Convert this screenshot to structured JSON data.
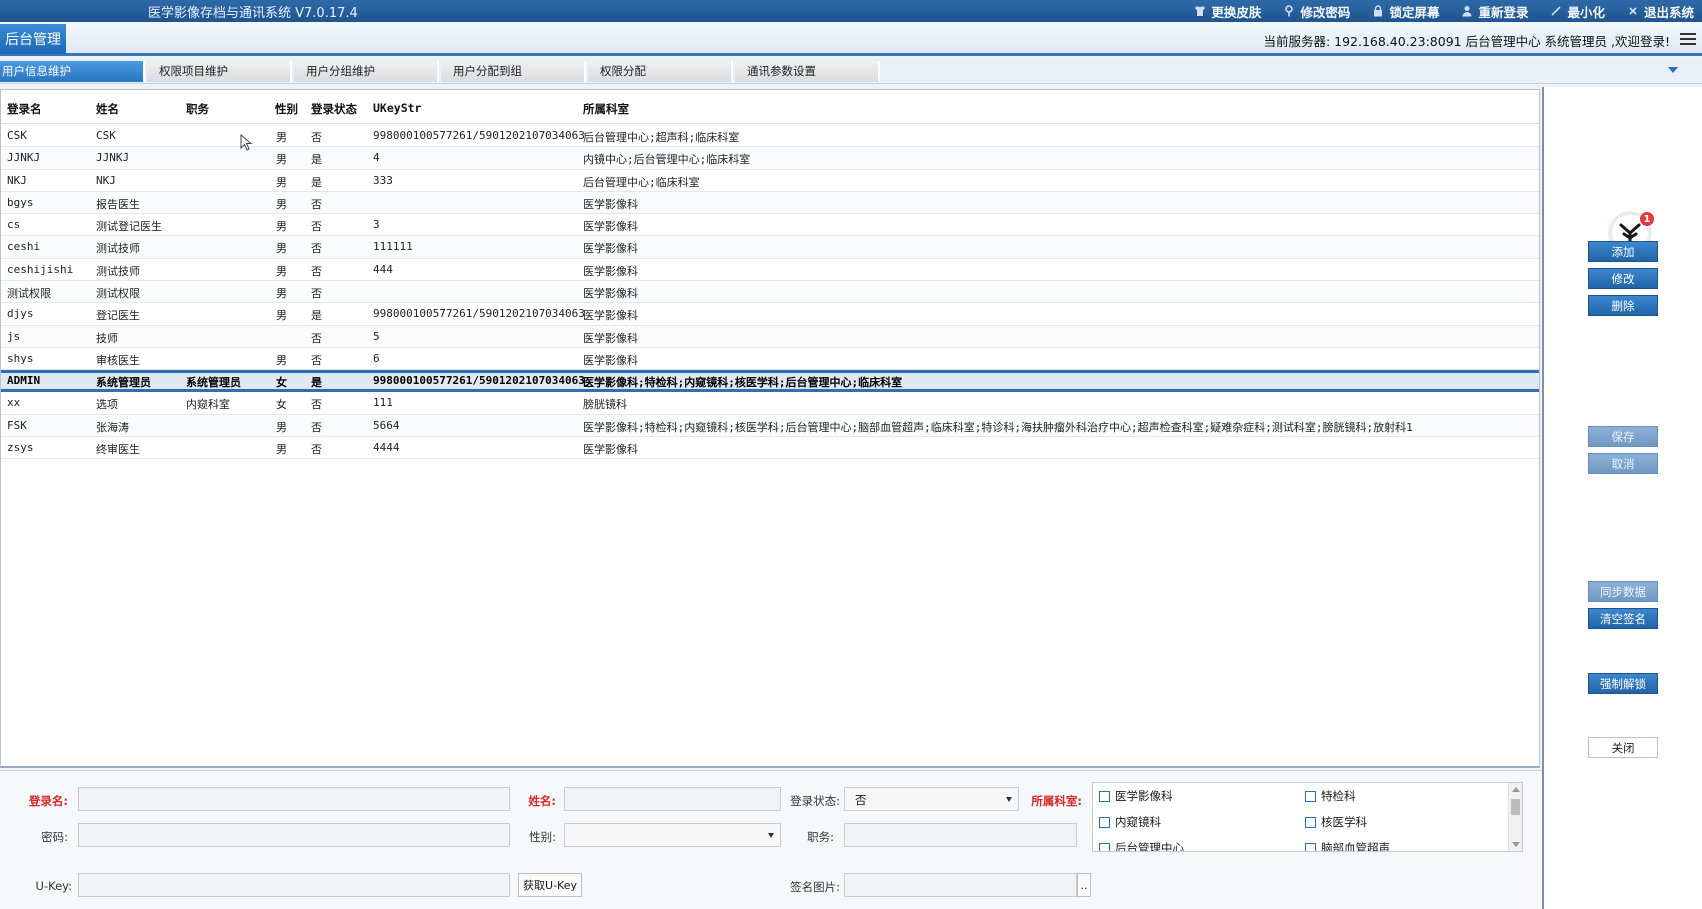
{
  "window": {
    "title": "医学影像存档与通讯系统 V7.0.17.4",
    "actions": [
      {
        "label": "更换皮肤",
        "icon": "shirt-icon"
      },
      {
        "label": "修改密码",
        "icon": "key-icon"
      },
      {
        "label": "锁定屏幕",
        "icon": "lock-icon"
      },
      {
        "label": "重新登录",
        "icon": "user-icon"
      },
      {
        "label": "最小化",
        "icon": "minimize-icon"
      },
      {
        "label": "退出系统",
        "icon": "exit-icon"
      }
    ]
  },
  "header": {
    "module": "后台管理",
    "server_info": "当前服务器: 192.168.40.23:8091 后台管理中心 系统管理员 ,欢迎登录!"
  },
  "tabs": [
    {
      "label": "用户信息维护",
      "active": true
    },
    {
      "label": "权限项目维护",
      "active": false
    },
    {
      "label": "用户分组维护",
      "active": false
    },
    {
      "label": "用户分配到组",
      "active": false
    },
    {
      "label": "权限分配",
      "active": false
    },
    {
      "label": "通讯参数设置",
      "active": false
    }
  ],
  "table": {
    "columns": [
      "登录名",
      "姓名",
      "职务",
      "性别",
      "登录状态",
      "UKeyStr",
      "所属科室"
    ],
    "rows": [
      [
        "CSK",
        "CSK",
        "",
        "男",
        "否",
        "998000100577261/5901202107034063",
        "后台管理中心;超声科;临床科室"
      ],
      [
        "JJNKJ",
        "JJNKJ",
        "",
        "男",
        "是",
        "4",
        "内镜中心;后台管理中心;临床科室"
      ],
      [
        "NKJ",
        "NKJ",
        "",
        "男",
        "是",
        "333",
        "后台管理中心;临床科室"
      ],
      [
        "bgys",
        "报告医生",
        "",
        "男",
        "否",
        "",
        "医学影像科"
      ],
      [
        "cs",
        "测试登记医生",
        "",
        "男",
        "否",
        "3",
        "医学影像科"
      ],
      [
        "ceshi",
        "测试技师",
        "",
        "男",
        "否",
        "111111",
        "医学影像科"
      ],
      [
        "ceshijishi",
        "测试技师",
        "",
        "男",
        "否",
        "444",
        "医学影像科"
      ],
      [
        "测试权限",
        "测试权限",
        "",
        "男",
        "否",
        "",
        "医学影像科"
      ],
      [
        "djys",
        "登记医生",
        "",
        "男",
        "是",
        "998000100577261/5901202107034063",
        "医学影像科"
      ],
      [
        "js",
        "技师",
        "",
        "",
        "否",
        "5",
        "医学影像科"
      ],
      [
        "shys",
        "审核医生",
        "",
        "男",
        "否",
        "6",
        "医学影像科"
      ],
      [
        "ADMIN",
        "系统管理员",
        "系统管理员",
        "女",
        "是",
        "998000100577261/5901202107034063",
        "医学影像科;特检科;内窥镜科;核医学科;后台管理中心;临床科室"
      ],
      [
        "xx",
        "选项",
        "内窥科室",
        "女",
        "否",
        "111",
        "膀胱镜科"
      ],
      [
        "FSK",
        "张海涛",
        "",
        "男",
        "否",
        "5664",
        "医学影像科;特检科;内窥镜科;核医学科;后台管理中心;脑部血管超声;临床科室;特诊科;海扶肿瘤外科治疗中心;超声检查科室;疑难杂症科;测试科室;膀胱镜科;放射科1"
      ],
      [
        "zsys",
        "终审医生",
        "",
        "男",
        "否",
        "4444",
        "医学影像科"
      ]
    ],
    "selected_row": 11
  },
  "side_buttons": {
    "add": "添加",
    "edit": "修改",
    "delete": "删除",
    "save": "保存",
    "cancel": "取消",
    "sync": "同步数据",
    "clear_sign": "清空签名",
    "force_unlock": "强制解锁",
    "close": "关闭",
    "badge_count": "1"
  },
  "form": {
    "login_label": "登录名:",
    "login_value": "",
    "name_label": "姓名:",
    "name_value": "",
    "status_label": "登录状态:",
    "status_value": "否",
    "dept_label": "所属科室:",
    "password_label": "密码:",
    "password_value": "",
    "gender_label": "性别:",
    "gender_value": "",
    "title_label": "职务:",
    "title_value": "",
    "ukey_label": "U-Key:",
    "ukey_value": "",
    "get_ukey": "获取U-Key",
    "sign_label": "签名图片:",
    "sign_value": "",
    "browse": "..",
    "departments": [
      "医学影像科",
      "特检科",
      "内窥镜科",
      "核医学科",
      "后台管理中心",
      "脑部血管超声"
    ]
  },
  "colors": {
    "accent": "#2a74c2",
    "required": "#d42a2a",
    "titlebar": "#2e6aa8"
  }
}
